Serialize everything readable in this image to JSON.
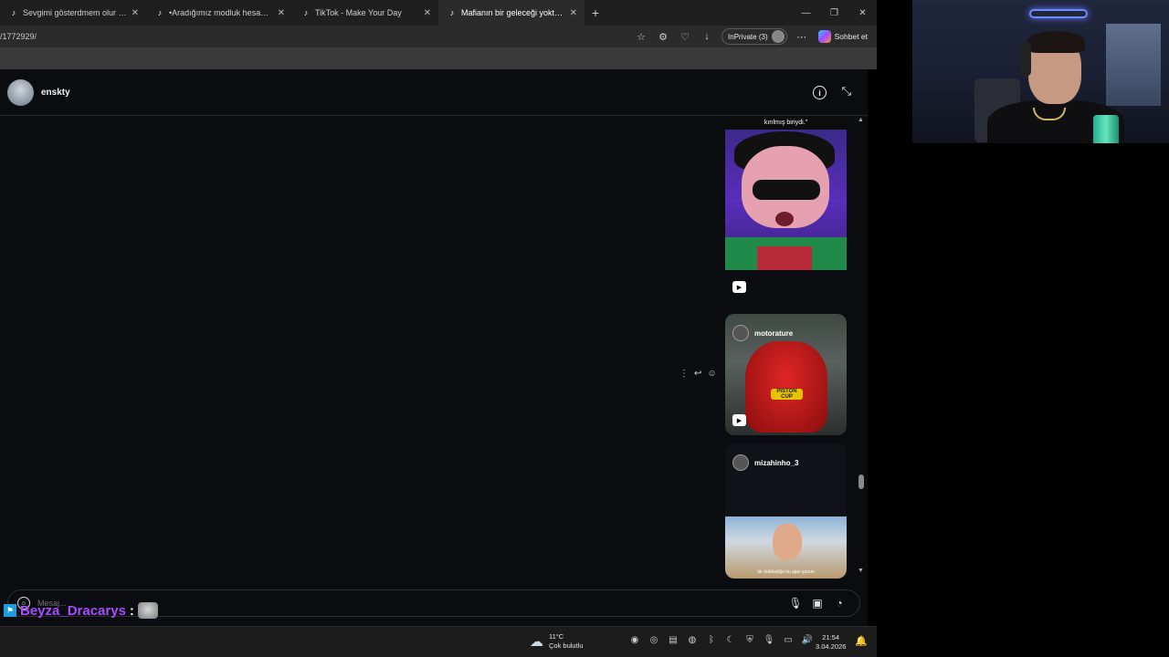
{
  "browser": {
    "tabs": [
      {
        "title": "Sevgimi gösterdmem olur biter.. #y",
        "active": false
      },
      {
        "title": "•Aradığımız modluk hesab. #viking",
        "active": false
      },
      {
        "title": "TikTok - Make Your Day",
        "active": false
      },
      {
        "title": "Mafianın bir geleceği yoktur.#keşfi",
        "active": true
      }
    ],
    "url": "/1772929/",
    "inprivate_label": "InPrivate (3)",
    "copilot_label": "Sohbet et"
  },
  "chat": {
    "username": "enskty",
    "reels": [
      {
        "caption": "kırılmış biriydi.\"",
        "overlay_text": "ANİMASYON"
      },
      {
        "username": "motorature",
        "badge": "PISTON CUP"
      },
      {
        "username": "mizahinho_3",
        "subtitle": "bir dakikalığa bu ajan şunun"
      }
    ],
    "composer_placeholder": "Mesaj..."
  },
  "stream_overlay": {
    "chat_user": "Beyza_Dracarys",
    "chat_separator": ":",
    "name_color": "#a84dff"
  },
  "taskbar": {
    "temperature": "11°C",
    "weather": "Çok bulutlu",
    "time": "21:54",
    "date": "3.04.2026"
  }
}
